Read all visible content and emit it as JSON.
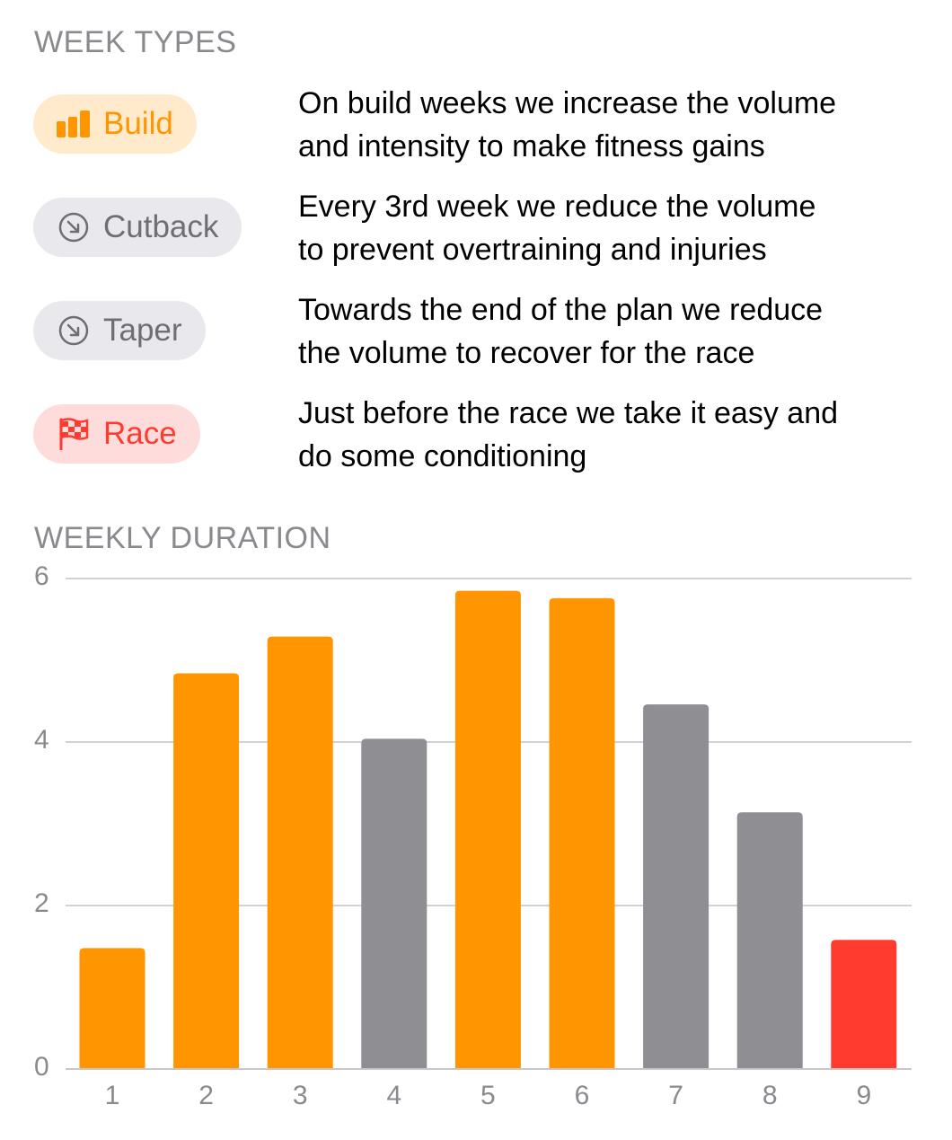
{
  "week_types": {
    "title": "WEEK TYPES",
    "items": [
      {
        "label": "Build",
        "icon": "bar-chart-icon",
        "color": "#ff9500",
        "bg": "#ffebcc",
        "description": [
          "On build weeks we increase the volume",
          "and intensity to make fitness gains"
        ]
      },
      {
        "label": "Cutback",
        "icon": "arrow-down-right-circle-icon",
        "color": "#6e6e73",
        "bg": "#e8e8ed",
        "description": [
          "Every 3rd week we reduce the volume",
          "to prevent overtraining and injuries"
        ]
      },
      {
        "label": "Taper",
        "icon": "arrow-down-right-circle-icon",
        "color": "#6e6e73",
        "bg": "#e8e8ed",
        "description": [
          "Towards the end of the plan we reduce",
          "the volume to recover for the race"
        ]
      },
      {
        "label": "Race",
        "icon": "checkered-flag-icon",
        "color": "#ff3b30",
        "bg": "#ffdcdc",
        "description": [
          "Just before the race we take it easy and",
          "do some conditioning"
        ]
      }
    ]
  },
  "chart_data": {
    "type": "bar",
    "title": "WEEKLY DURATION",
    "xlabel": "",
    "ylabel": "",
    "categories": [
      "1",
      "2",
      "3",
      "4",
      "5",
      "6",
      "7",
      "8",
      "9"
    ],
    "values": [
      1.48,
      4.84,
      5.29,
      4.04,
      5.85,
      5.76,
      4.46,
      3.14,
      1.58
    ],
    "week_types": [
      "Build",
      "Build",
      "Build",
      "Cutback",
      "Build",
      "Build",
      "Taper",
      "Taper",
      "Race"
    ],
    "colors": {
      "Build": "#ff9500",
      "Cutback": "#8e8e93",
      "Taper": "#8e8e93",
      "Race": "#ff3b30"
    },
    "ylim": [
      0,
      6
    ],
    "yticks": [
      "0",
      "2",
      "4",
      "6"
    ],
    "grid": true,
    "legend": "none"
  }
}
